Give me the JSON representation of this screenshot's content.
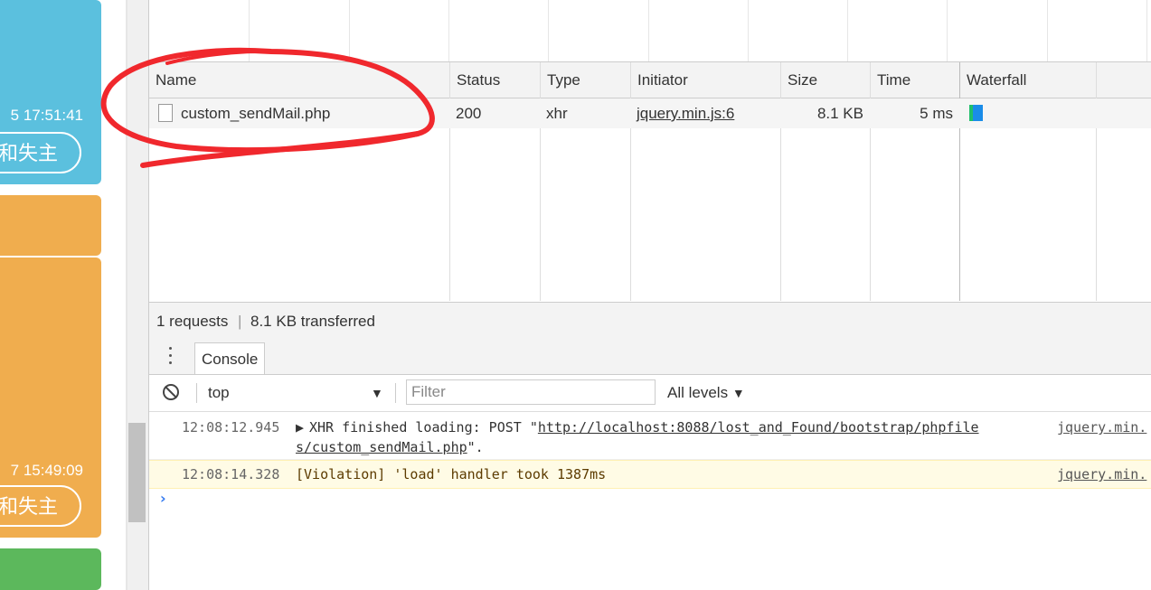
{
  "page": {
    "cards": [
      {
        "timestamp": "5 17:51:41",
        "button": "和失主"
      },
      {
        "timestamp": "7 15:49:09",
        "button": "和失主"
      }
    ]
  },
  "network": {
    "columns": {
      "name": "Name",
      "status": "Status",
      "type": "Type",
      "initiator": "Initiator",
      "size": "Size",
      "time": "Time",
      "waterfall": "Waterfall"
    },
    "requests": [
      {
        "name": "custom_sendMail.php",
        "status": "200",
        "type": "xhr",
        "initiator": "jquery.min.js:6",
        "size": "8.1 KB",
        "time": "5 ms"
      }
    ],
    "summary": {
      "requests": "1 requests",
      "transferred": "8.1 KB transferred"
    }
  },
  "drawer": {
    "tab": "Console",
    "context": "top",
    "filter_placeholder": "Filter",
    "levels": "All levels"
  },
  "console": {
    "messages": [
      {
        "time": "12:08:12.945",
        "prefix": "XHR finished loading: POST \"",
        "url_part1": "http://localhost:8088/lost_and_Found/bootstrap/phpfile",
        "url_part2": "s/custom_sendMail.php",
        "suffix": "\".",
        "source": "jquery.min."
      },
      {
        "time": "12:08:14.328",
        "text": "[Violation] 'load' handler took 1387ms",
        "source": "jquery.min."
      }
    ]
  },
  "colors": {
    "blue_card": "#5bc0de",
    "orange_card": "#f0ad4e",
    "green_card": "#5cb85c",
    "annotation": "#f0282d",
    "violation_bg": "#fffbe5"
  }
}
